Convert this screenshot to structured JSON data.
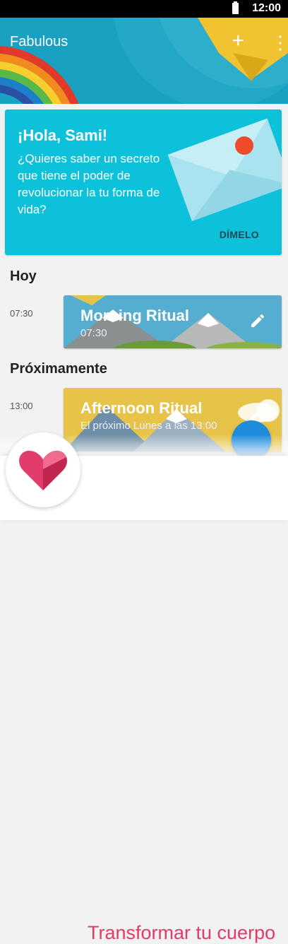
{
  "status": {
    "time": "12:00"
  },
  "appbar": {
    "title": "Fabulous"
  },
  "hero": {
    "title": "¡Hola, Sami!",
    "body": "¿Quieres saber un secreto que tiene el poder de revolucionar la tu forma de vida?",
    "cta": "DÍMELO"
  },
  "today": {
    "heading": "Hoy",
    "time": "07:30",
    "ritual_title": "Morning Ritual",
    "ritual_sub": "07:30"
  },
  "upcoming": {
    "heading": "Próximamente",
    "time": "13:00",
    "ritual_title": "Afternoon Ritual",
    "ritual_sub": "El próximo Lunes a las 13:00"
  },
  "goal": {
    "label": "Transformar tu cuerpo"
  },
  "colors": {
    "accent": "#0ec1db",
    "goal": "#e33a67",
    "fab": "#1e8bdb"
  }
}
